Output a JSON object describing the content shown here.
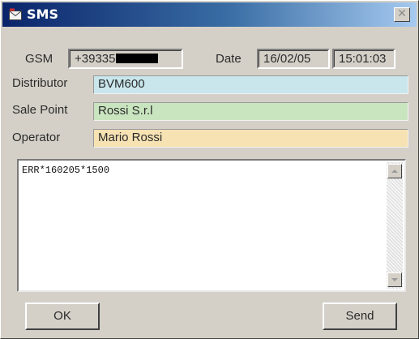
{
  "window": {
    "title": "SMS",
    "close_glyph": "✕"
  },
  "header": {
    "gsm_label": "GSM",
    "gsm_value": "+39335",
    "date_label": "Date",
    "date_value": "16/02/05",
    "time_value": "15:01:03"
  },
  "fields": [
    {
      "label": "Distributor",
      "value": "BVM600",
      "color": "#c8e6ec"
    },
    {
      "label": "Sale Point",
      "value": "Rossi S.r.l",
      "color": "#c9e5c0"
    },
    {
      "label": "Operator",
      "value": "Mario Rossi",
      "color": "#f6e2b3"
    }
  ],
  "message": {
    "text": "ERR*160205*1500"
  },
  "buttons": {
    "ok_label": "OK",
    "send_label": "Send"
  },
  "icons": {
    "title": "sms-envelope-icon",
    "close": "close-icon",
    "scroll_up": "scroll-up-arrow-icon",
    "scroll_down": "scroll-down-arrow-icon"
  }
}
